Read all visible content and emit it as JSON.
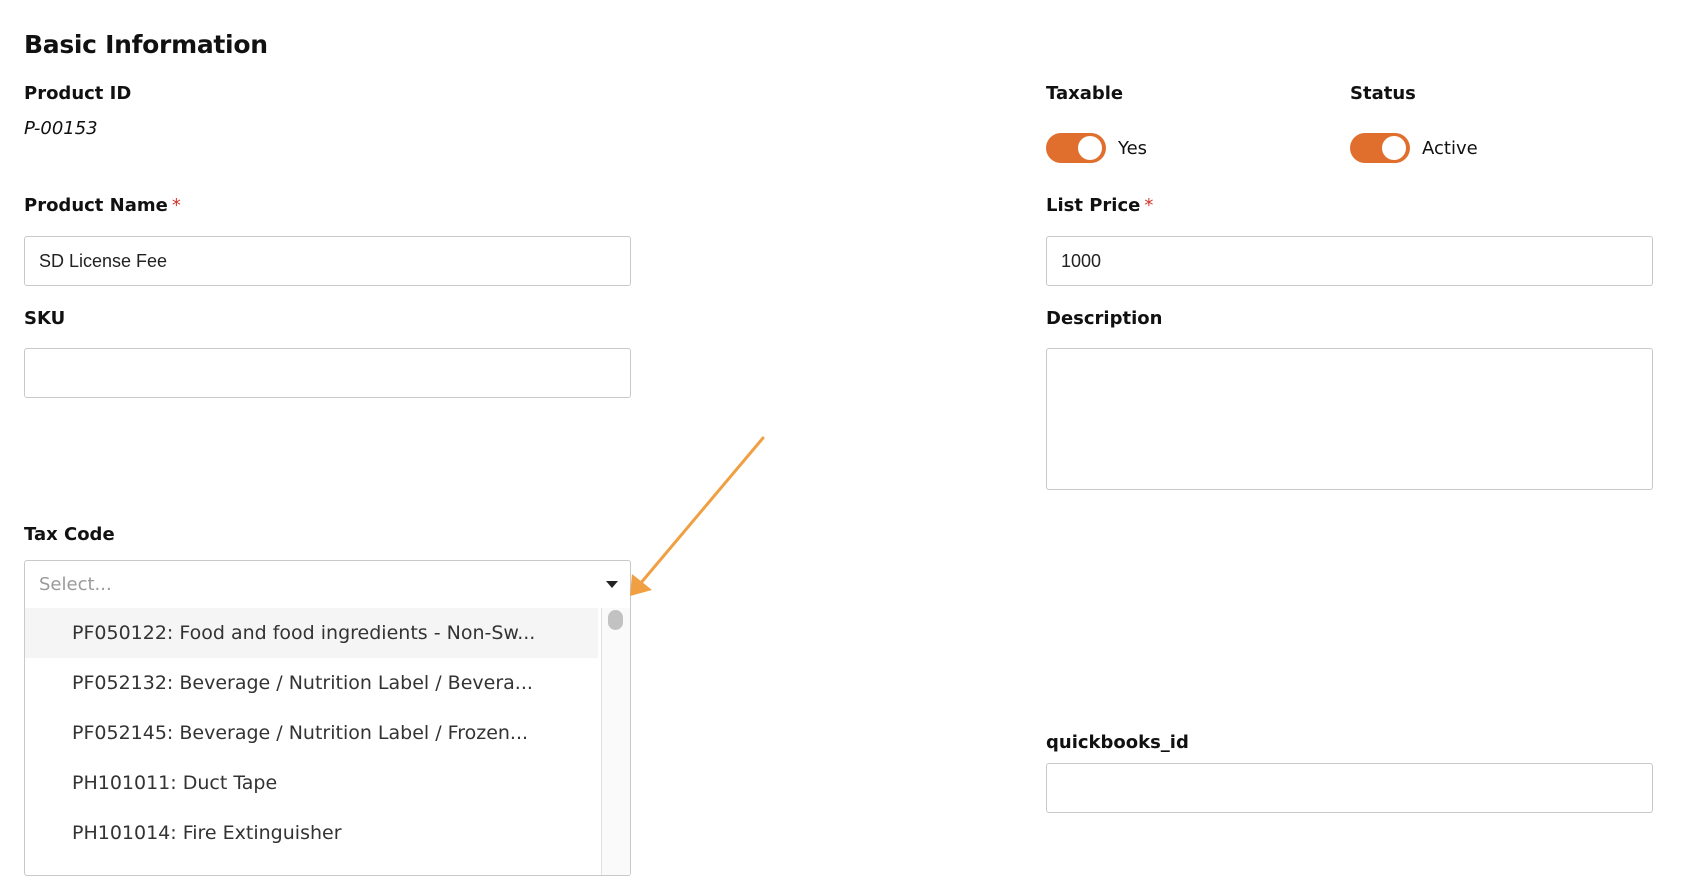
{
  "section": {
    "title": "Basic Information"
  },
  "fields": {
    "product_id": {
      "label": "Product ID",
      "value": "P-00153"
    },
    "taxable": {
      "label": "Taxable",
      "state_text": "Yes"
    },
    "status": {
      "label": "Status",
      "state_text": "Active"
    },
    "product_name": {
      "label": "Product Name",
      "required_mark": "*",
      "value": "SD License Fee"
    },
    "list_price": {
      "label": "List Price",
      "required_mark": "*",
      "value": "1000"
    },
    "sku": {
      "label": "SKU",
      "value": ""
    },
    "description": {
      "label": "Description",
      "value": ""
    },
    "tax_code": {
      "label": "Tax Code",
      "placeholder": "Select...",
      "options": [
        "PF050122: Food and food ingredients - Non-Sw...",
        "PF052132: Beverage / Nutrition Label / Bevera...",
        "PF052145: Beverage / Nutrition Label / Frozen...",
        "PH101011: Duct Tape",
        "PH101014: Fire Extinguisher"
      ]
    },
    "quickbooks_id": {
      "label": "quickbooks_id",
      "value": ""
    }
  },
  "colors": {
    "toggle_on": "#e06f2e",
    "annotation_arrow": "#f0a043",
    "required": "#d0342c"
  }
}
